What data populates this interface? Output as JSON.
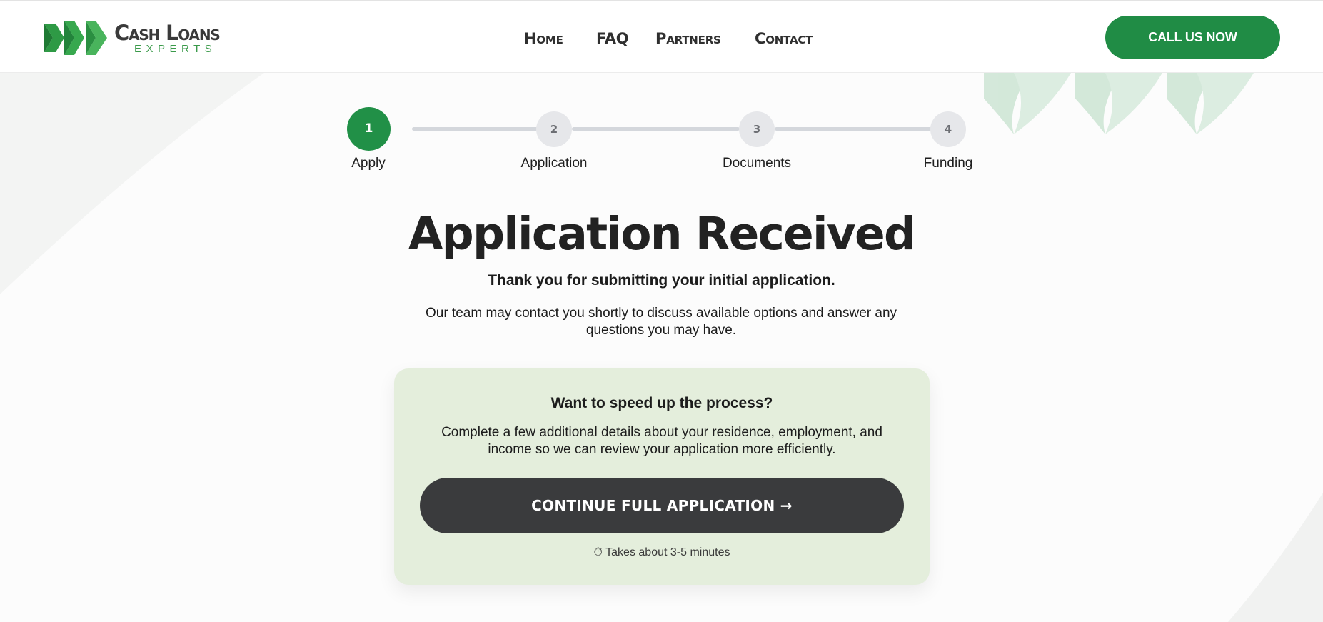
{
  "header": {
    "logo": {
      "title": "Cash Loans",
      "subtitle": "EXPERTS"
    },
    "nav": [
      {
        "label": "Home"
      },
      {
        "label": "FAQ"
      },
      {
        "label": "Partners"
      },
      {
        "label": "Contact"
      }
    ],
    "call_label": "CALL US NOW"
  },
  "stepper": {
    "steps": [
      {
        "number": "1",
        "label": "Apply",
        "state": "active"
      },
      {
        "number": "2",
        "label": "Application",
        "state": "pending"
      },
      {
        "number": "3",
        "label": "Documents",
        "state": "pending"
      },
      {
        "number": "4",
        "label": "Funding",
        "state": "pending"
      }
    ]
  },
  "main": {
    "title": "Application Received",
    "subtitle": "Thank you for submitting your initial application.",
    "body": "Our team may contact you shortly to discuss available options and answer any questions you may have."
  },
  "card": {
    "title": "Want to speed up the process?",
    "text": "Complete a few additional details about your residence, employment, and income so we can review your application more efficiently.",
    "button_label": "CONTINUE FULL APPLICATION →",
    "note": "⏱ Takes about 3-5 minutes"
  },
  "colors": {
    "brand_green": "#208c45",
    "card_bg": "#e4eedc",
    "dark_button": "#3a3b3d"
  }
}
